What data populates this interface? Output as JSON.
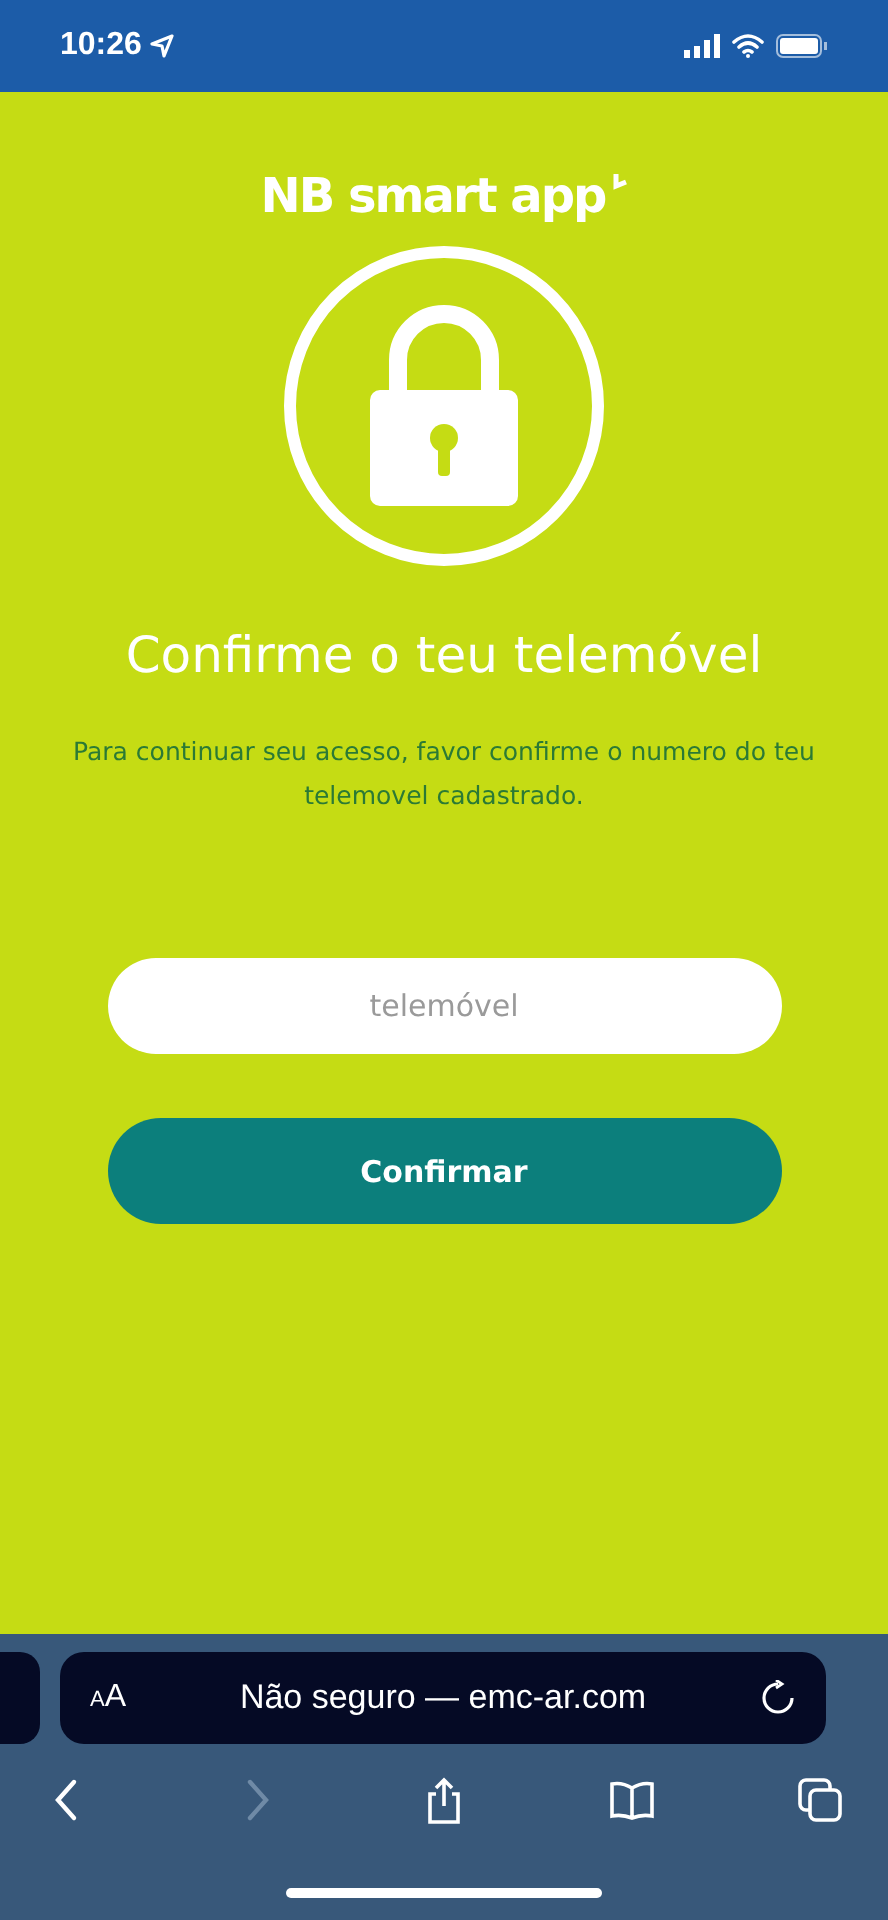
{
  "status_bar": {
    "time": "10:26"
  },
  "logo": {
    "text": "NB smart app"
  },
  "title": "Confirme o teu telemóvel",
  "description": "Para continuar seu acesso, favor confirme o numero do teu telemovel cadastrado.",
  "phone_field": {
    "placeholder": "telemóvel"
  },
  "confirm_button": {
    "label": "Confirmar"
  },
  "browser": {
    "text_size_button": "AA",
    "address": "Não seguro — emc-ar.com",
    "toolbar": [
      {
        "kind": "back",
        "disabled": false
      },
      {
        "kind": "forward",
        "disabled": true
      },
      {
        "kind": "share",
        "disabled": false
      },
      {
        "kind": "bookmarks",
        "disabled": false
      },
      {
        "kind": "tabs",
        "disabled": false
      }
    ]
  }
}
